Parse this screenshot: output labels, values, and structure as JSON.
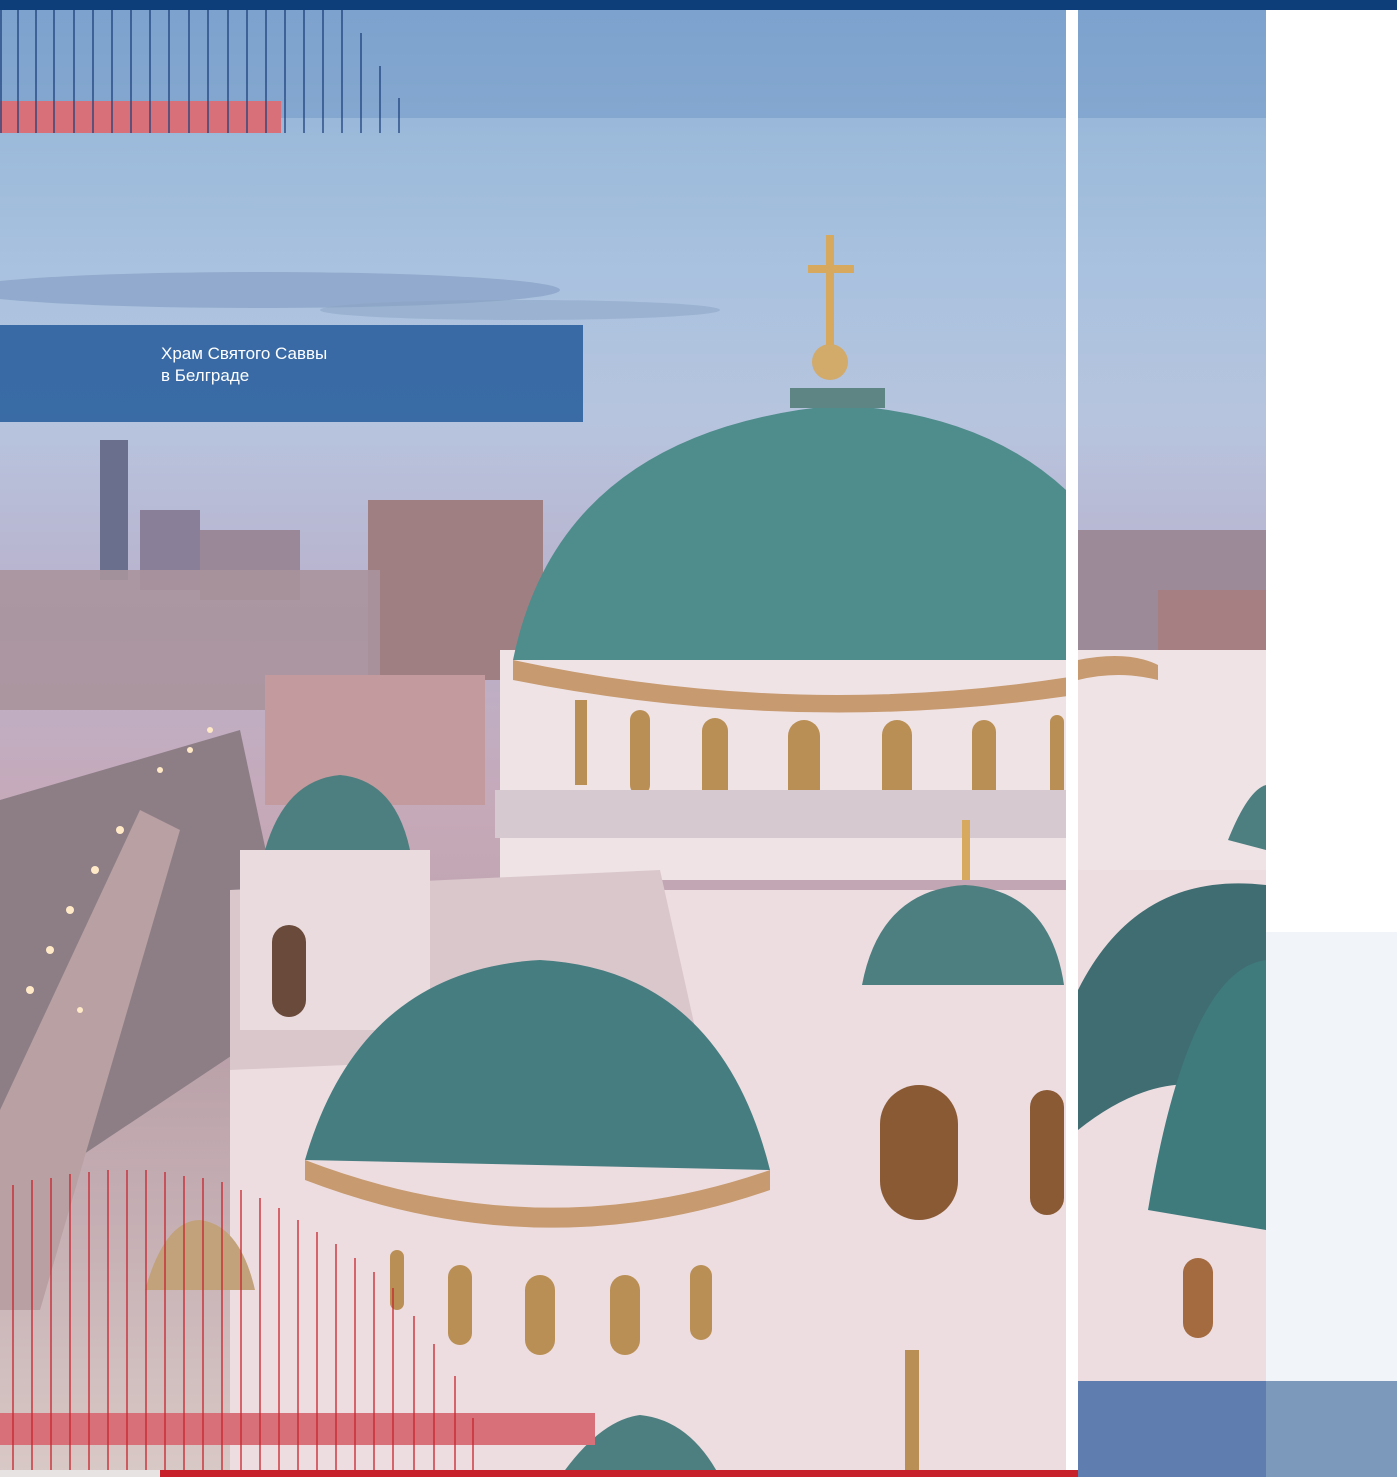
{
  "caption": {
    "line1": "Храм Святого Саввы",
    "line2": "в Белграде"
  },
  "colors": {
    "brand_navy": "#0d3e7a",
    "caption_blue": "#2f63a0",
    "accent_red": "#c7222b",
    "accent_pink": "#d8707a",
    "pale_panel": "#f1f4f9"
  },
  "image": {
    "subject": "cathedral-photo"
  }
}
